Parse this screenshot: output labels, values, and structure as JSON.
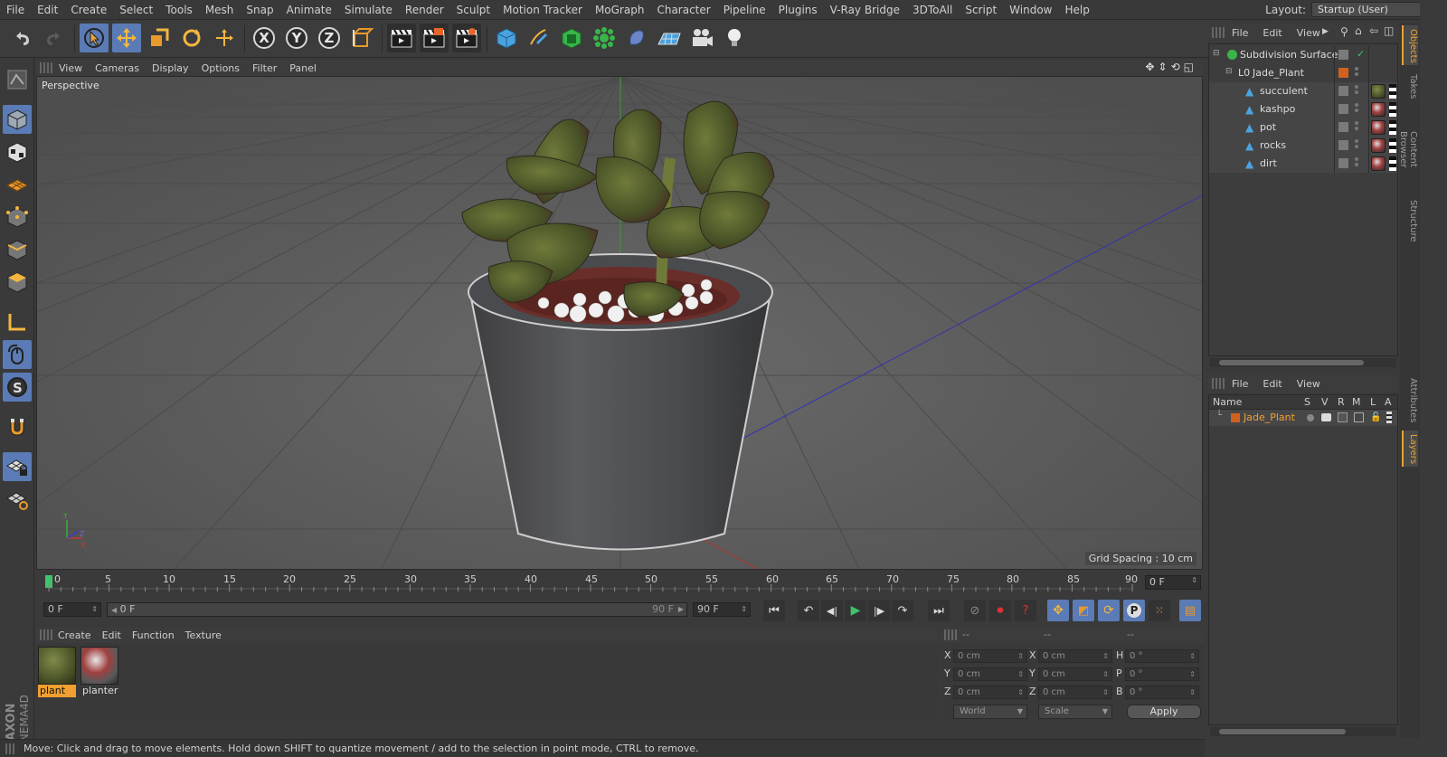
{
  "menubar": {
    "items": [
      "File",
      "Edit",
      "Create",
      "Select",
      "Tools",
      "Mesh",
      "Snap",
      "Animate",
      "Simulate",
      "Render",
      "Sculpt",
      "Motion Tracker",
      "MoGraph",
      "Character",
      "Pipeline",
      "Plugins",
      "V-Ray Bridge",
      "3DToAll",
      "Script",
      "Window",
      "Help"
    ],
    "layout_label": "Layout:",
    "layout_value": "Startup (User)"
  },
  "toolbar": {
    "axis_x": "X",
    "axis_y": "Y",
    "axis_z": "Z"
  },
  "viewport": {
    "menu": [
      "View",
      "Cameras",
      "Display",
      "Options",
      "Filter",
      "Panel"
    ],
    "camera_label": "Perspective",
    "grid_spacing": "Grid Spacing : 10 cm"
  },
  "timeline": {
    "ticks": [
      "0",
      "5",
      "10",
      "15",
      "20",
      "25",
      "30",
      "35",
      "40",
      "45",
      "50",
      "55",
      "60",
      "65",
      "70",
      "75",
      "80",
      "85",
      "90"
    ],
    "current_frame": "0 F"
  },
  "transport": {
    "start_frame": "0 F",
    "range_start": "0 F",
    "range_end": "90 F",
    "end_frame": "90 F"
  },
  "materials": {
    "menu": [
      "Create",
      "Edit",
      "Function",
      "Texture"
    ],
    "items": [
      {
        "name": "plant",
        "selected": true
      },
      {
        "name": "planter",
        "selected": false
      }
    ]
  },
  "coordinates": {
    "header_dash": "--",
    "rows": [
      {
        "pos_label": "X",
        "pos": "0 cm",
        "size_label": "X",
        "size": "0 cm",
        "rot_label": "H",
        "rot": "0 °"
      },
      {
        "pos_label": "Y",
        "pos": "0 cm",
        "size_label": "Y",
        "size": "0 cm",
        "rot_label": "P",
        "rot": "0 °"
      },
      {
        "pos_label": "Z",
        "pos": "0 cm",
        "size_label": "Z",
        "size": "0 cm",
        "rot_label": "B",
        "rot": "0 °"
      }
    ],
    "mode_world": "World",
    "mode_scale": "Scale",
    "apply": "Apply"
  },
  "status": {
    "text": "Move: Click and drag to move elements. Hold down SHIFT to quantize movement / add to the selection in point mode, CTRL to remove."
  },
  "object_manager": {
    "menu": [
      "File",
      "Edit",
      "View"
    ],
    "objects": [
      {
        "name": "Subdivision Surface"
      },
      {
        "name": "Jade_Plant"
      },
      {
        "name": "succulent"
      },
      {
        "name": "kashpo"
      },
      {
        "name": "pot"
      },
      {
        "name": "rocks"
      },
      {
        "name": "dirt"
      }
    ]
  },
  "layers": {
    "menu": [
      "File",
      "Edit",
      "View"
    ],
    "columns": [
      "Name",
      "S",
      "V",
      "R",
      "M",
      "L",
      "A"
    ],
    "layer_name": "Jade_Plant",
    "layer_color": "#d0621e"
  },
  "side_tabs": [
    "Objects",
    "Takes",
    "Content Browser",
    "Structure",
    "Attributes",
    "Layers"
  ],
  "colors": {
    "accent": "#5a7bb5",
    "highlight": "#f0a030",
    "viewport_bg": "#5a5a5a"
  }
}
